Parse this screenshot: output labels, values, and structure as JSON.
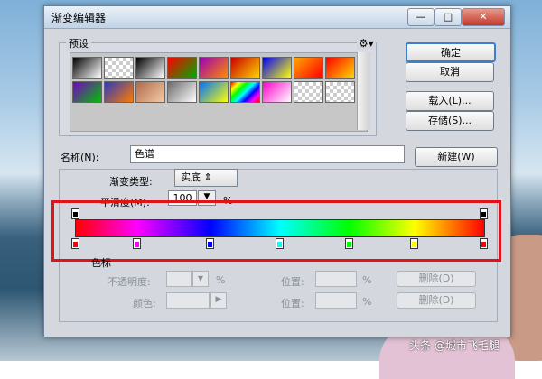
{
  "dialog": {
    "title": "渐变编辑器",
    "window_controls": {
      "minimize": "—",
      "maximize": "□",
      "close": "✕"
    }
  },
  "presets": {
    "label": "预设",
    "gear_icon": "gear-icon",
    "swatches": [
      [
        "#000000",
        "#ffffff"
      ],
      [
        "checker",
        "checker"
      ],
      [
        "#000000",
        "#ffffff"
      ],
      [
        "#ff0000",
        "#00aa00"
      ],
      [
        "#9b00b5",
        "#ff8a00"
      ],
      [
        "#c80000",
        "#ffd400"
      ],
      [
        "#0000ff",
        "#ffff00"
      ],
      [
        "#ffa600",
        "#ff0000"
      ],
      [
        "#ff0000",
        "#ffd400"
      ],
      [
        "#7a00c8",
        "#00c000"
      ],
      [
        "#2a3bbf",
        "#ff7a00"
      ],
      [
        "#b06a4a",
        "#f5cba7"
      ],
      [
        "#6a6a6a",
        "#ffffff"
      ],
      [
        "#0070ff",
        "#ffff00"
      ],
      [
        "rainbow",
        "rainbow"
      ],
      [
        "#ff00cc",
        "#ffffff"
      ],
      [
        "checker",
        "checker"
      ],
      [
        "checker",
        "checker"
      ]
    ]
  },
  "buttons": {
    "ok": "确定",
    "cancel": "取消",
    "load": "载入(L)...",
    "save": "存储(S)...",
    "new": "新建(W)"
  },
  "name": {
    "label": "名称(N):",
    "value": "色谱"
  },
  "gradient": {
    "type_label": "渐变类型:",
    "type_value": "实底 ⇕",
    "smoothness_label": "平滑度(M):",
    "smoothness_value": "100",
    "smoothness_unit": "%",
    "opacity_stops": [
      0,
      1
    ],
    "color_stops": [
      {
        "pos": 0.0,
        "color": "#ff0000"
      },
      {
        "pos": 0.15,
        "color": "#ff00ff"
      },
      {
        "pos": 0.33,
        "color": "#0000ff"
      },
      {
        "pos": 0.5,
        "color": "#00ffff"
      },
      {
        "pos": 0.67,
        "color": "#00ff00"
      },
      {
        "pos": 0.83,
        "color": "#ffff00"
      },
      {
        "pos": 1.0,
        "color": "#ff0000"
      }
    ]
  },
  "stops": {
    "label": "色标",
    "opacity_label": "不透明度:",
    "opacity_unit": "%",
    "location_label": "位置:",
    "location_unit": "%",
    "delete_label": "删除(D)",
    "color_label": "颜色:",
    "color_arrow": "▶"
  },
  "watermark": "头条 @城市飞毛腿",
  "accent": "#e0121a"
}
